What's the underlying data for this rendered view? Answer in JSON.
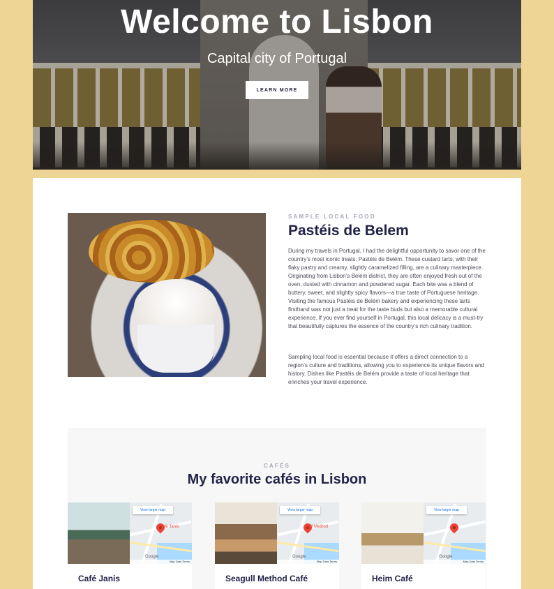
{
  "hero": {
    "title": "Welcome to Lisbon",
    "subtitle": "Capital city of Portugal",
    "button_label": "LEARN MORE"
  },
  "food": {
    "eyebrow": "SAMPLE LOCAL FOOD",
    "title": "Pastéis de Belem",
    "image_alt": "Pastéis de Belém tarts with hot chocolate",
    "paragraph1": "During my travels in Portugal, I had the delightful opportunity to savor one of the country’s most iconic treats: Pastéis de Belém. These custard tarts, with their flaky pastry and creamy, slightly caramelized filling, are a culinary masterpiece. Originating from Lisbon’s Belém district, they are often enjoyed fresh out of the oven, dusted with cinnamon and powdered sugar. Each bite was a blend of buttery, sweet, and slightly spicy flavors—a true taste of Portuguese heritage. Visiting the famous Pastéis de Belém bakery and experiencing these tarts firsthand was not just a treat for the taste buds but also a memorable cultural experience. If you ever find yourself in Portugal, this local delicacy is a must-try that beautifully captures the essence of the country’s rich culinary tradition.",
    "paragraph2": "Sampling local food is essential because it offers a direct connection to a region’s culture and traditions, allowing you to experience its unique flavors and history. Dishes like Pastéis de Belém provide a taste of local heritage that enriches your travel experience."
  },
  "cafes": {
    "eyebrow": "CAFÉS",
    "title": "My favorite cafés in Lisbon",
    "map_link_label": "View larger map",
    "map_attribution": "Map Data  Terms",
    "google_label": "Google",
    "items": [
      {
        "name": "Café Janis",
        "pin_label": "Café Janis"
      },
      {
        "name": "Seagull Method Café",
        "pin_label": "gull Method"
      },
      {
        "name": "Heim Café",
        "pin_label": ""
      }
    ]
  },
  "colors": {
    "page_bg": "#efd595",
    "heading": "#23234a",
    "eyebrow": "#a9a9b6",
    "map_pin": "#ea4335"
  }
}
